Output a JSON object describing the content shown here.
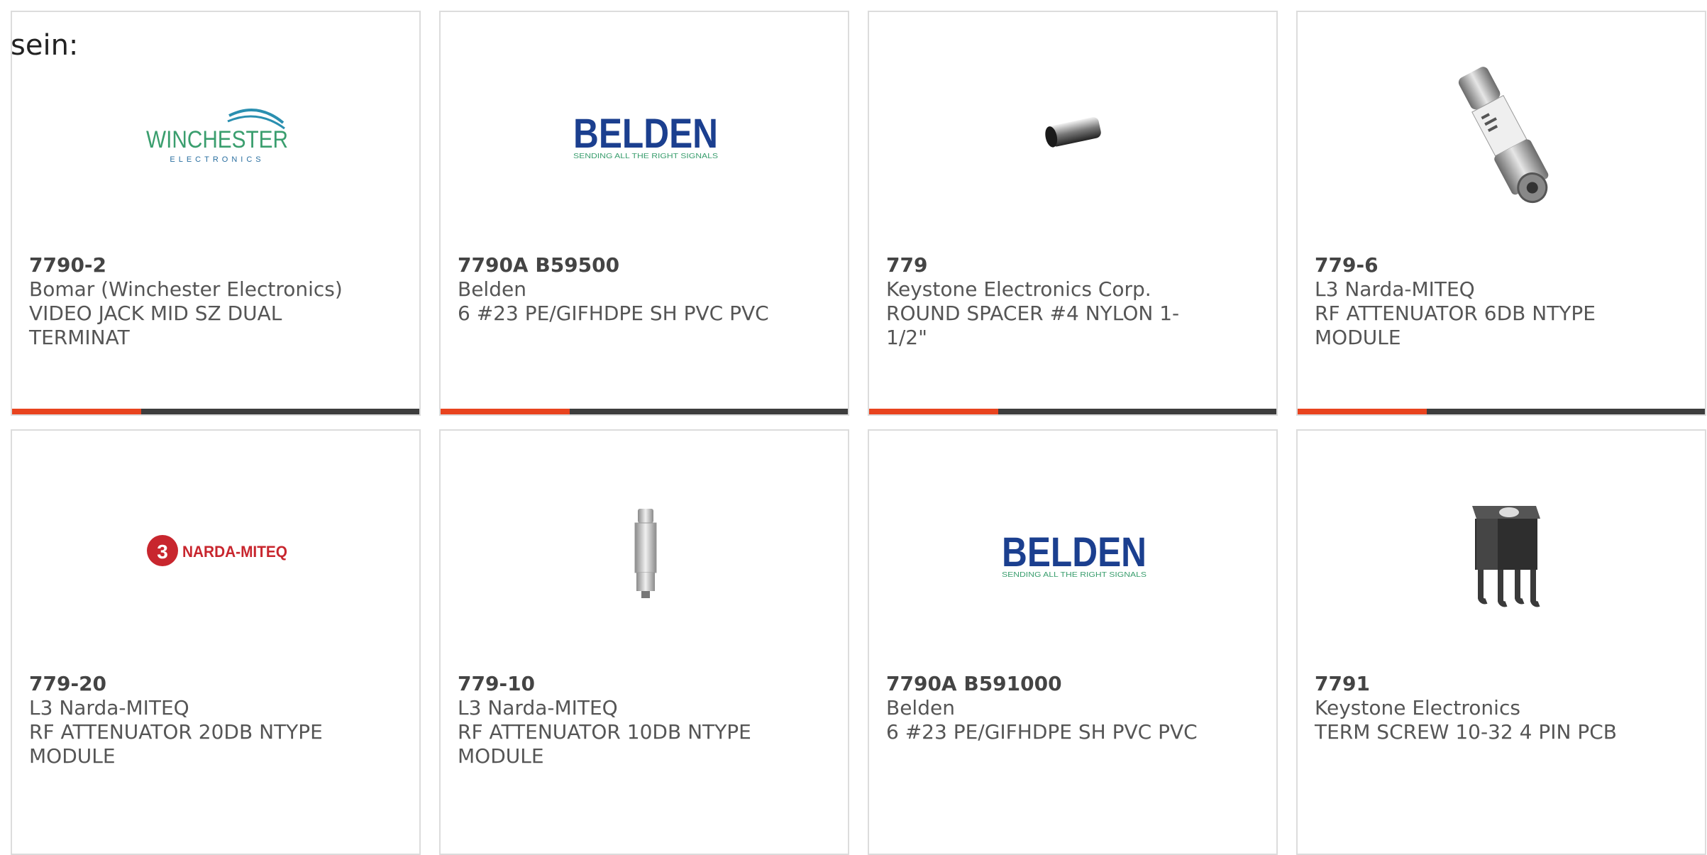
{
  "intro_text": "sein:",
  "colors": {
    "accent": "#e8431e",
    "bar": "#3d3d3d",
    "border": "#dcdcdc",
    "text": "#555555"
  },
  "products": [
    {
      "part": "7790-2",
      "maker": "Bomar (Winchester Electronics)",
      "desc1": "VIDEO JACK MID SZ DUAL",
      "desc2": "TERMINAT",
      "image": "winchester-logo",
      "logo_lines": [
        "WINCHESTER",
        "ELECTRONICS"
      ]
    },
    {
      "part": "7790A B59500",
      "maker": "Belden",
      "desc1": "6 #23 PE/GIFHDPE SH PVC PVC",
      "desc2": "",
      "image": "belden-logo",
      "logo_lines": [
        "BELDEN",
        "SENDING ALL THE RIGHT SIGNALS"
      ]
    },
    {
      "part": "779",
      "maker": "Keystone Electronics Corp.",
      "desc1": "ROUND SPACER #4 NYLON 1-",
      "desc2": "1/2\"",
      "image": "round-spacer-photo"
    },
    {
      "part": "779-6",
      "maker": "L3 Narda-MITEQ",
      "desc1": "RF ATTENUATOR 6DB NTYPE",
      "desc2": "MODULE",
      "image": "rf-attenuator-photo"
    },
    {
      "part": "779-20",
      "maker": "L3 Narda-MITEQ",
      "desc1": "RF ATTENUATOR 20DB NTYPE",
      "desc2": "MODULE",
      "image": "narda-miteq-logo",
      "logo_lines": [
        "3",
        "NARDA-MITEQ"
      ]
    },
    {
      "part": "779-10",
      "maker": "L3 Narda-MITEQ",
      "desc1": "RF ATTENUATOR 10DB NTYPE",
      "desc2": "MODULE",
      "image": "small-attenuator-photo"
    },
    {
      "part": "7790A B591000",
      "maker": "Belden",
      "desc1": "6 #23 PE/GIFHDPE SH PVC PVC",
      "desc2": "",
      "image": "belden-logo",
      "logo_lines": [
        "BELDEN",
        "SENDING ALL THE RIGHT SIGNALS"
      ]
    },
    {
      "part": "7791",
      "maker": "Keystone Electronics",
      "desc1": "TERM SCREW 10-32 4 PIN PCB",
      "desc2": "",
      "image": "terminal-screw-photo"
    }
  ]
}
